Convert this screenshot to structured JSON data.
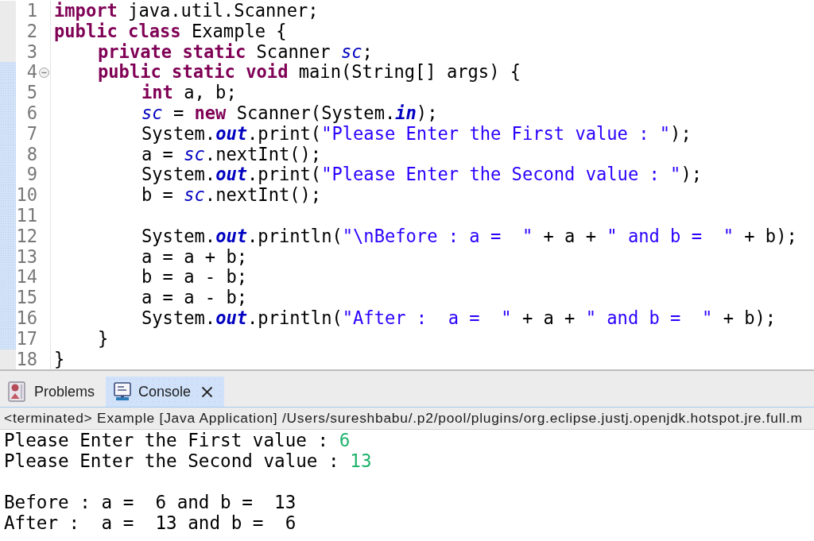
{
  "editor": {
    "lines": [
      {
        "number": "1",
        "fold_marker": false,
        "range_marked": false,
        "tokens": [
          {
            "kind": "keyword",
            "text": "import"
          },
          {
            "kind": "plain",
            "text": " java.util.Scanner;"
          }
        ]
      },
      {
        "number": "2",
        "fold_marker": false,
        "range_marked": false,
        "tokens": [
          {
            "kind": "keyword",
            "text": "public class"
          },
          {
            "kind": "plain",
            "text": " Example {"
          }
        ],
        "children": [
          {
            "number": "3",
            "fold_marker": false,
            "range_marked": false,
            "tokens": [
              {
                "kind": "keyword",
                "text": "private static"
              },
              {
                "kind": "plain",
                "text": " Scanner "
              },
              {
                "kind": "field",
                "text": "sc"
              },
              {
                "kind": "plain",
                "text": ";"
              }
            ]
          },
          {
            "number": "4",
            "fold_marker": true,
            "range_marked": true,
            "tokens": [
              {
                "kind": "keyword",
                "text": "public static void"
              },
              {
                "kind": "plain",
                "text": " main(String[] args) {"
              }
            ],
            "children": [
              {
                "number": "5",
                "fold_marker": false,
                "range_marked": true,
                "tokens": [
                  {
                    "kind": "keyword",
                    "text": "int"
                  },
                  {
                    "kind": "plain",
                    "text": " a, b;"
                  }
                ]
              },
              {
                "number": "6",
                "fold_marker": false,
                "range_marked": true,
                "tokens": [
                  {
                    "kind": "field",
                    "text": "sc"
                  },
                  {
                    "kind": "plain",
                    "text": " = "
                  },
                  {
                    "kind": "keyword",
                    "text": "new"
                  },
                  {
                    "kind": "plain",
                    "text": " Scanner(System."
                  },
                  {
                    "kind": "static_field",
                    "text": "in"
                  },
                  {
                    "kind": "plain",
                    "text": ");"
                  }
                ]
              },
              {
                "number": "7",
                "fold_marker": false,
                "range_marked": true,
                "tokens": [
                  {
                    "kind": "plain",
                    "text": "System."
                  },
                  {
                    "kind": "static_field",
                    "text": "out"
                  },
                  {
                    "kind": "plain",
                    "text": ".print("
                  },
                  {
                    "kind": "string",
                    "text": "\"Please Enter the First value : \""
                  },
                  {
                    "kind": "plain",
                    "text": ");"
                  }
                ]
              },
              {
                "number": "8",
                "fold_marker": false,
                "range_marked": true,
                "tokens": [
                  {
                    "kind": "plain",
                    "text": "a = "
                  },
                  {
                    "kind": "field",
                    "text": "sc"
                  },
                  {
                    "kind": "plain",
                    "text": ".nextInt();"
                  }
                ]
              },
              {
                "number": "9",
                "fold_marker": false,
                "range_marked": true,
                "tokens": [
                  {
                    "kind": "plain",
                    "text": "System."
                  },
                  {
                    "kind": "static_field",
                    "text": "out"
                  },
                  {
                    "kind": "plain",
                    "text": ".print("
                  },
                  {
                    "kind": "string",
                    "text": "\"Please Enter the Second value : \""
                  },
                  {
                    "kind": "plain",
                    "text": ");"
                  }
                ]
              },
              {
                "number": "10",
                "fold_marker": false,
                "range_marked": true,
                "tokens": [
                  {
                    "kind": "plain",
                    "text": "b = "
                  },
                  {
                    "kind": "field",
                    "text": "sc"
                  },
                  {
                    "kind": "plain",
                    "text": ".nextInt();"
                  }
                ]
              },
              {
                "number": "11",
                "fold_marker": false,
                "range_marked": true
              },
              {
                "number": "12",
                "fold_marker": false,
                "range_marked": true,
                "tokens": [
                  {
                    "kind": "plain",
                    "text": "System."
                  },
                  {
                    "kind": "static_field",
                    "text": "out"
                  },
                  {
                    "kind": "plain",
                    "text": ".println("
                  },
                  {
                    "kind": "string",
                    "text": "\"\\nBefore : a =  \""
                  },
                  {
                    "kind": "plain",
                    "text": " + a + "
                  },
                  {
                    "kind": "string",
                    "text": "\" and b =  \""
                  },
                  {
                    "kind": "plain",
                    "text": " + b);"
                  }
                ]
              },
              {
                "number": "13",
                "fold_marker": false,
                "range_marked": true,
                "tokens": [
                  {
                    "kind": "plain",
                    "text": "a = a + b;"
                  }
                ]
              },
              {
                "number": "14",
                "fold_marker": false,
                "range_marked": true,
                "tokens": [
                  {
                    "kind": "plain",
                    "text": "b = a - b;"
                  }
                ]
              },
              {
                "number": "15",
                "fold_marker": false,
                "range_marked": true,
                "tokens": [
                  {
                    "kind": "plain",
                    "text": "a = a - b;"
                  }
                ]
              },
              {
                "number": "16",
                "fold_marker": false,
                "range_marked": true,
                "tokens": [
                  {
                    "kind": "plain",
                    "text": "System."
                  },
                  {
                    "kind": "static_field",
                    "text": "out"
                  },
                  {
                    "kind": "plain",
                    "text": ".println("
                  },
                  {
                    "kind": "string",
                    "text": "\"After :  a =  \""
                  },
                  {
                    "kind": "plain",
                    "text": " + a + "
                  },
                  {
                    "kind": "string",
                    "text": "\" and b =  \""
                  },
                  {
                    "kind": "plain",
                    "text": " + b);"
                  }
                ]
              }
            ]
          },
          {
            "number": "17",
            "fold_marker": false,
            "range_marked": true,
            "tokens": [
              {
                "kind": "plain",
                "text": "}"
              }
            ]
          }
        ]
      },
      {
        "number": "18",
        "fold_marker": false,
        "range_marked": false,
        "tokens": [
          {
            "kind": "plain",
            "text": "}"
          }
        ]
      }
    ]
  },
  "console": {
    "tabs": [
      {
        "kind": "problems",
        "label": "Problems",
        "selected": false,
        "closable": false
      },
      {
        "kind": "console",
        "label": "Console",
        "selected": true,
        "closable": true
      }
    ],
    "status": "<terminated> Example [Java Application] /Users/sureshbabu/.p2/pool/plugins/org.eclipse.justj.openjdk.hotspot.jre.full.m",
    "lines": [
      {
        "kind": "prompt",
        "text": "Please Enter the First value : ",
        "input": "6"
      },
      {
        "kind": "prompt",
        "text": "Please Enter the Second value : ",
        "input": "13"
      },
      {
        "kind": "blank"
      },
      {
        "kind": "output",
        "text": "Before : a =  6 and b =  13"
      },
      {
        "kind": "output",
        "text": "After :  a =  13 and b =  6"
      }
    ]
  }
}
